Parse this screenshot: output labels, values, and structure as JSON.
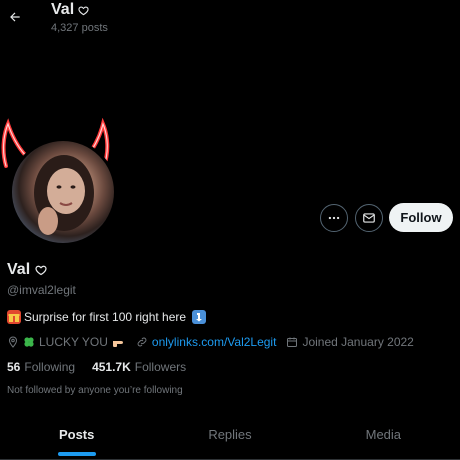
{
  "header": {
    "name": "Val",
    "post_count": "4,327 posts"
  },
  "profile": {
    "display_name": "Val",
    "handle": "@imval2legit",
    "bio": "Surprise for first 100 right here",
    "location": "LUCKY YOU",
    "website": "onlylinks.com/Val2Legit",
    "joined": "Joined January 2022",
    "following_count": "56",
    "following_label": "Following",
    "followers_count": "451.7K",
    "followers_label": "Followers",
    "not_followed_text": "Not followed by anyone you’re following"
  },
  "actions": {
    "follow_label": "Follow"
  },
  "tabs": [
    {
      "label": "Posts",
      "active": true
    },
    {
      "label": "Replies",
      "active": false
    },
    {
      "label": "Media",
      "active": false
    }
  ],
  "colors": {
    "background": "#000000",
    "accent": "#1d9bf0",
    "secondary_text": "#71767b",
    "follow_button_bg": "#eff3f4"
  },
  "icons": [
    "back-arrow-icon",
    "heart-outline-icon",
    "more-icon",
    "mail-icon",
    "gift-icon",
    "arrow-turn-icon",
    "location-icon",
    "clover-icon",
    "pointing-hand-icon",
    "link-icon",
    "calendar-icon"
  ]
}
